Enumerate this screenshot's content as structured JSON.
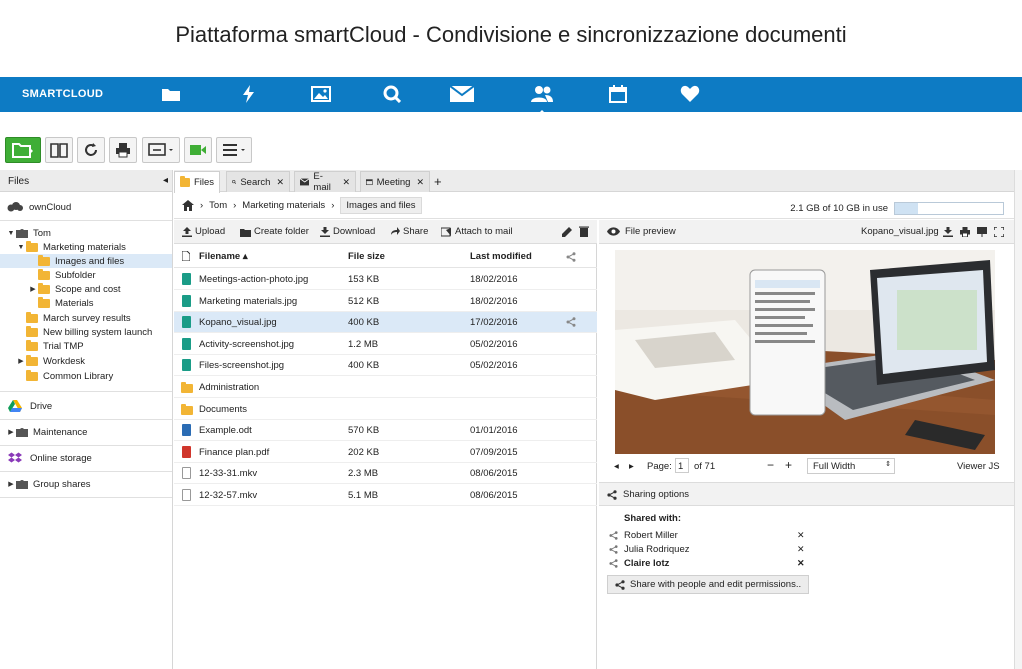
{
  "page_title": "Piattaforma smartCloud - Condivisione e sincronizzazione documenti",
  "brand": "SMARTCLOUD",
  "colors": {
    "accent": "#0d7bc4",
    "green": "#3fae36",
    "folder": "#f2b535",
    "selected": "#dbe9f7"
  },
  "topnav": [
    "folder-icon",
    "activity-icon",
    "image-icon",
    "search-icon",
    "mail-icon",
    "contacts-icon",
    "calendar-icon",
    "favorites-icon"
  ],
  "sidebar": {
    "header": "Files",
    "roots": {
      "owncloud": "ownCloud",
      "drive": "Drive",
      "maintenance": "Maintenance",
      "online_storage": "Online storage",
      "group_shares": "Group shares"
    },
    "tree": {
      "tom": "Tom",
      "marketing": "Marketing materials",
      "images_files": "Images and files",
      "subfolder": "Subfolder",
      "scope_cost": "Scope and cost",
      "materials": "Materials",
      "march_survey": "March survey results",
      "new_billing": "New billing system launch",
      "trial_tmp": "Trial TMP",
      "workdesk": "Workdesk",
      "common_library": "Common Library"
    }
  },
  "tabs": {
    "files": "Files",
    "search": "Search",
    "email": "E-mail",
    "meeting": "Meeting",
    "add": "+"
  },
  "breadcrumb": {
    "tom": "Tom",
    "marketing": "Marketing materials",
    "current": "Images and files"
  },
  "quota": {
    "text": "2.1 GB of 10 GB in use",
    "fraction": 0.21
  },
  "actions": {
    "upload": "Upload",
    "create_folder": "Create folder",
    "download": "Download",
    "share": "Share",
    "attach": "Attach to mail"
  },
  "columns": {
    "filename": "Filename",
    "size": "File size",
    "modified": "Last modified"
  },
  "files": [
    {
      "name": "Meetings-action-photo.jpg",
      "size": "153 KB",
      "date": "18/02/2016",
      "kind": "image"
    },
    {
      "name": "Marketing materials.jpg",
      "size": "512 KB",
      "date": "18/02/2016",
      "kind": "image"
    },
    {
      "name": "Kopano_visual.jpg",
      "size": "400 KB",
      "date": "17/02/2016",
      "kind": "image"
    },
    {
      "name": "Activity-screenshot.jpg",
      "size": "1.2 MB",
      "date": "05/02/2016",
      "kind": "image"
    },
    {
      "name": "Files-screenshot.jpg",
      "size": "400 KB",
      "date": "05/02/2016",
      "kind": "image"
    },
    {
      "name": "Administration",
      "size": "",
      "date": "",
      "kind": "folder"
    },
    {
      "name": "Documents",
      "size": "",
      "date": "",
      "kind": "folder"
    },
    {
      "name": "Example.odt",
      "size": "570 KB",
      "date": "01/01/2016",
      "kind": "doc"
    },
    {
      "name": "Finance plan.pdf",
      "size": "202 KB",
      "date": "07/09/2015",
      "kind": "pdf"
    },
    {
      "name": "12-33-31.mkv",
      "size": "2.3 MB",
      "date": "08/06/2015",
      "kind": "video"
    },
    {
      "name": "12-32-57.mkv",
      "size": "5.1 MB",
      "date": "08/06/2015",
      "kind": "video"
    }
  ],
  "preview": {
    "header": "File preview",
    "filename": "Kopano_visual.jpg",
    "page_label": "Page:",
    "page": "1",
    "of": "of 71",
    "zoom": "Full Width",
    "viewer": "Viewer JS"
  },
  "sharing": {
    "header": "Sharing options",
    "shared_with": "Shared with:",
    "people": [
      "Robert Miller",
      "Julia Rodriquez",
      "Claire lotz"
    ],
    "remove": "✕",
    "button": "Share with people and edit permissions.."
  }
}
